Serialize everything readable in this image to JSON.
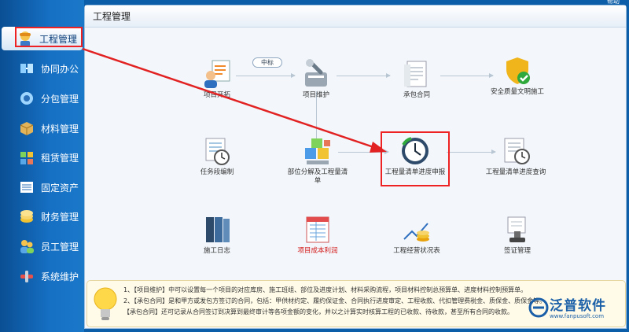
{
  "topbar": {
    "right_text": "帮助"
  },
  "sidebar": {
    "items": [
      {
        "label": "工程管理",
        "icon": "engineer-icon",
        "active": true
      },
      {
        "label": "协同办公",
        "icon": "collaboration-icon"
      },
      {
        "label": "分包管理",
        "icon": "subcontract-icon"
      },
      {
        "label": "材料管理",
        "icon": "material-box-icon"
      },
      {
        "label": "租赁管理",
        "icon": "lease-icon"
      },
      {
        "label": "固定资产",
        "icon": "asset-icon"
      },
      {
        "label": "财务管理",
        "icon": "finance-icon"
      },
      {
        "label": "员工管理",
        "icon": "staff-icon"
      },
      {
        "label": "系统维护",
        "icon": "tools-icon"
      }
    ]
  },
  "panel": {
    "title": "工程管理"
  },
  "flow": {
    "bid_pill": "中标",
    "nodes": {
      "project_start": "项目开拓",
      "project_maintain": "项目维护",
      "contract": "承包合同",
      "safety": "安全质量文明施工",
      "task_schedule": "任务段编制",
      "breakdown": "部位分解及工程量清单",
      "progress_report": "工程量清单进度申报",
      "progress_query": "工程量清单进度查询",
      "construction_log": "施工日志",
      "cost_profit": "项目成本利润",
      "business_status": "工程经营状况表",
      "visa_mgmt": "签证管理"
    }
  },
  "notes": [
    "1、【项目维护】中可以设置每一个项目的对应库房、施工班组、部位及进度计划、材料采购流程，项目材料控制总预算单、进度材料控制预算单。",
    "2、【承包合同】是和甲方或发包方签订的合同，包括：甲供材约定、履约保证金、合同执行进度审定、工程收款、代扣管理费税金、质保金、质保金等。",
    "【承包合同】还可记录从合同签订到决算到最终审计等各项金额的变化，并以之计算实时核算工程的已收款、待收款，甚至所有合同的收款。"
  ],
  "logo": {
    "text": "泛普软件",
    "url": "www.fanpusoft.com"
  },
  "colors": {
    "accent": "#1a78c9",
    "highlight": "#e22222",
    "arrow": "#e22222"
  }
}
